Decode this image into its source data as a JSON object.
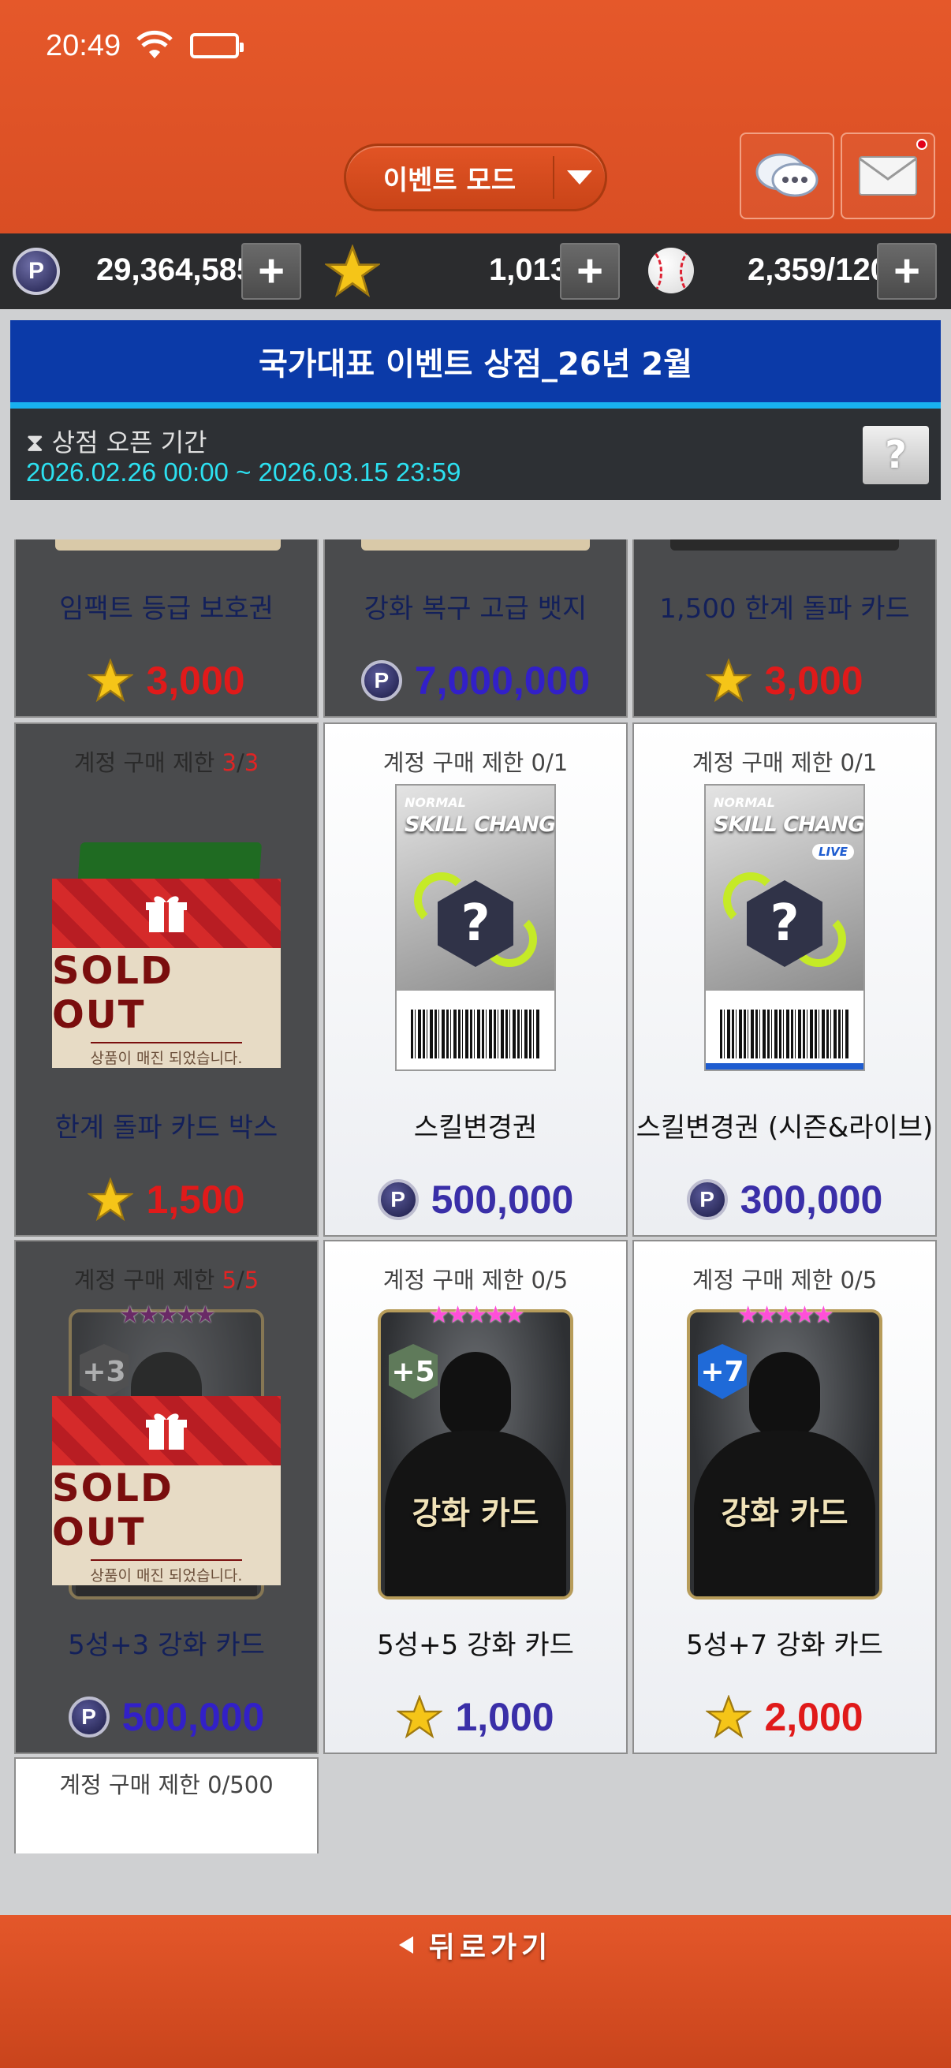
{
  "status": {
    "time": "20:49"
  },
  "header": {
    "mode_label": "이벤트 모드"
  },
  "resources": {
    "points": "29,364,585",
    "stars": "1,013",
    "balls": "2,359/120"
  },
  "shop": {
    "title": "국가대표 이벤트 상점_26년 2월",
    "period_label": "상점 오픈 기간",
    "period_dates": "2026.02.26 00:00 ~ 2026.03.15 23:59",
    "help": "?"
  },
  "items_partial": [
    {
      "name": "임팩트 등급 보호권",
      "price": "3,000",
      "currency": "star-icon"
    },
    {
      "name": "강화 복구 고급 뱃지",
      "price": "7,000,000",
      "currency": "point-coin-icon"
    },
    {
      "name": "1,500 한계 돌파 카드",
      "price": "3,000",
      "currency": "star-icon"
    }
  ],
  "items": [
    {
      "limit_prefix": "계정 구매 제한 ",
      "limit_used": "3",
      "limit_sep": "/",
      "limit_max": "3",
      "name": "한계 돌파 카드 박스",
      "price": "1,500",
      "currency": "star-icon",
      "sold_out": true
    },
    {
      "limit": "계정 구매 제한 0/1",
      "name": "스킬변경권",
      "price": "500,000",
      "currency": "point-coin-icon",
      "ticket_top": "NORMAL",
      "ticket_main": "SKILL CHANGE"
    },
    {
      "limit": "계정 구매 제한 0/1",
      "name": "스킬변경권 (시즌&라이브)",
      "price": "300,000",
      "currency": "point-coin-icon",
      "ticket_top": "NORMAL",
      "ticket_main": "SKILL CHANGE",
      "ticket_badge": "LIVE"
    },
    {
      "limit_prefix": "계정 구매 제한 ",
      "limit_used": "5",
      "limit_sep": "/",
      "limit_max": "5",
      "name": "5성+3 강화 카드",
      "price": "500,000",
      "currency": "point-coin-icon",
      "sold_out": true,
      "badge": "+3"
    },
    {
      "limit": "계정 구매 제한 0/5",
      "name": "5성+5 강화 카드",
      "price": "1,000",
      "currency": "star-icon",
      "badge": "+5",
      "card_text": "강화 카드"
    },
    {
      "limit": "계정 구매 제한 0/5",
      "name": "5성+7 강화 카드",
      "price": "2,000",
      "currency": "star-icon",
      "badge": "+7",
      "card_text": "강화 카드"
    },
    {
      "limit": "계정 구매 제한 0/500"
    }
  ],
  "sold_out": {
    "big": "SOLD OUT",
    "small": "상품이 매진 되었습니다."
  },
  "stars_rating": "★★★★★",
  "footer": {
    "back_label": "뒤로가기"
  },
  "colors": {
    "accent_orange": "#d94e24",
    "title_blue": "#0b3aa8",
    "period_cyan": "#2ce0f0",
    "price_red": "#e01a1a",
    "price_purple": "#3a2fa8"
  }
}
